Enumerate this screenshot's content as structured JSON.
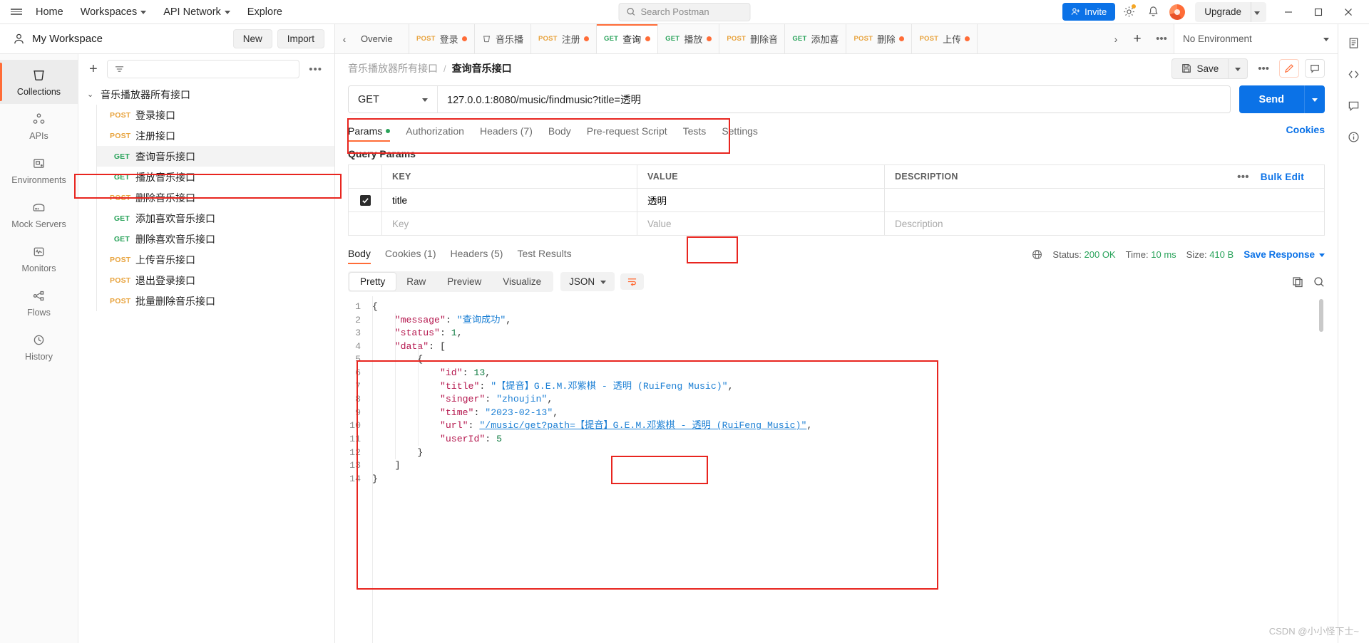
{
  "topbar": {
    "menu_icon": "hamburger-icon",
    "home": "Home",
    "workspaces": "Workspaces",
    "api_network": "API Network",
    "explore": "Explore",
    "search_placeholder": "Search Postman",
    "invite": "Invite",
    "upgrade": "Upgrade"
  },
  "workspace": {
    "name": "My Workspace",
    "new_label": "New",
    "import_label": "Import"
  },
  "rail": {
    "items": [
      {
        "label": "Collections",
        "icon": "collections-icon",
        "active": true
      },
      {
        "label": "APIs",
        "icon": "apis-icon",
        "active": false
      },
      {
        "label": "Environments",
        "icon": "environments-icon",
        "active": false
      },
      {
        "label": "Mock Servers",
        "icon": "mock-servers-icon",
        "active": false
      },
      {
        "label": "Monitors",
        "icon": "monitors-icon",
        "active": false
      },
      {
        "label": "Flows",
        "icon": "flows-icon",
        "active": false
      },
      {
        "label": "History",
        "icon": "history-icon",
        "active": false
      }
    ]
  },
  "tree": {
    "filter_placeholder": "",
    "collection": "音乐播放器所有接口",
    "requests": [
      {
        "method": "POST",
        "name": "登录接口",
        "selected": false
      },
      {
        "method": "POST",
        "name": "注册接口",
        "selected": false
      },
      {
        "method": "GET",
        "name": "查询音乐接口",
        "selected": true
      },
      {
        "method": "GET",
        "name": "播放音乐接口",
        "selected": false
      },
      {
        "method": "POST",
        "name": "删除音乐接口",
        "selected": false
      },
      {
        "method": "GET",
        "name": "添加喜欢音乐接口",
        "selected": false
      },
      {
        "method": "GET",
        "name": "删除喜欢音乐接口",
        "selected": false
      },
      {
        "method": "POST",
        "name": "上传音乐接口",
        "selected": false
      },
      {
        "method": "POST",
        "name": "退出登录接口",
        "selected": false
      },
      {
        "method": "POST",
        "name": "批量删除音乐接口",
        "selected": false
      }
    ]
  },
  "tabs": {
    "items": [
      {
        "method": "",
        "label": "Overvie",
        "unsaved": false,
        "active": false
      },
      {
        "method": "POST",
        "label": "登录",
        "unsaved": true,
        "active": false
      },
      {
        "method": "",
        "label": "音乐播",
        "unsaved": false,
        "active": false
      },
      {
        "method": "POST",
        "label": "注册",
        "unsaved": true,
        "active": false
      },
      {
        "method": "GET",
        "label": "查询",
        "unsaved": true,
        "active": true
      },
      {
        "method": "GET",
        "label": "播放",
        "unsaved": true,
        "active": false
      },
      {
        "method": "POST",
        "label": "删除音",
        "unsaved": false,
        "active": false
      },
      {
        "method": "GET",
        "label": "添加喜",
        "unsaved": false,
        "active": false
      },
      {
        "method": "POST",
        "label": "删除",
        "unsaved": true,
        "active": false
      },
      {
        "method": "POST",
        "label": "上传",
        "unsaved": true,
        "active": false
      }
    ],
    "environment": "No Environment"
  },
  "breadcrumb": {
    "collection": "音乐播放器所有接口",
    "separator": "/",
    "request": "查询音乐接口",
    "save_label": "Save"
  },
  "request": {
    "method": "GET",
    "url": "127.0.0.1:8080/music/findmusic?title=透明",
    "send_label": "Send",
    "cookies_link": "Cookies",
    "tabs": [
      {
        "label": "Params",
        "active": true,
        "dot": true
      },
      {
        "label": "Authorization",
        "active": false,
        "dot": false
      },
      {
        "label": "Headers (7)",
        "active": false,
        "dot": false
      },
      {
        "label": "Body",
        "active": false,
        "dot": false
      },
      {
        "label": "Pre-request Script",
        "active": false,
        "dot": false
      },
      {
        "label": "Tests",
        "active": false,
        "dot": false
      },
      {
        "label": "Settings",
        "active": false,
        "dot": false
      }
    ],
    "query_params_title": "Query Params",
    "table": {
      "headers": [
        "KEY",
        "VALUE",
        "DESCRIPTION"
      ],
      "bulk_edit": "Bulk Edit",
      "rows": [
        {
          "checked": true,
          "key": "title",
          "value": "透明",
          "description": ""
        }
      ],
      "placeholder_row": {
        "key": "Key",
        "value": "Value",
        "description": "Description"
      }
    }
  },
  "response": {
    "tabs": [
      {
        "label": "Body",
        "active": true
      },
      {
        "label": "Cookies (1)",
        "active": false
      },
      {
        "label": "Headers (5)",
        "active": false
      },
      {
        "label": "Test Results",
        "active": false
      }
    ],
    "status_label": "Status:",
    "status_value": "200 OK",
    "time_label": "Time:",
    "time_value": "10 ms",
    "size_label": "Size:",
    "size_value": "410 B",
    "save_response": "Save Response",
    "view_modes": [
      {
        "label": "Pretty",
        "active": true
      },
      {
        "label": "Raw",
        "active": false
      },
      {
        "label": "Preview",
        "active": false
      },
      {
        "label": "Visualize",
        "active": false
      }
    ],
    "format": "JSON",
    "body_lines": [
      {
        "n": "1",
        "indent": 0,
        "tokens": [
          {
            "t": "{",
            "c": "p"
          }
        ]
      },
      {
        "n": "2",
        "indent": 0,
        "tokens": [
          {
            "t": "    \"message\"",
            "c": "k"
          },
          {
            "t": ": ",
            "c": "p"
          },
          {
            "t": "\"查询成功\"",
            "c": "s"
          },
          {
            "t": ",",
            "c": "p"
          }
        ]
      },
      {
        "n": "3",
        "indent": 0,
        "tokens": [
          {
            "t": "    \"status\"",
            "c": "k"
          },
          {
            "t": ": ",
            "c": "p"
          },
          {
            "t": "1",
            "c": "n"
          },
          {
            "t": ",",
            "c": "p"
          }
        ]
      },
      {
        "n": "4",
        "indent": 0,
        "tokens": [
          {
            "t": "    \"data\"",
            "c": "k"
          },
          {
            "t": ": ",
            "c": "p"
          },
          {
            "t": "[",
            "c": "p"
          }
        ]
      },
      {
        "n": "5",
        "indent": 0,
        "tokens": [
          {
            "t": "        {",
            "c": "p"
          }
        ]
      },
      {
        "n": "6",
        "indent": 0,
        "tokens": [
          {
            "t": "            \"id\"",
            "c": "k"
          },
          {
            "t": ": ",
            "c": "p"
          },
          {
            "t": "13",
            "c": "n"
          },
          {
            "t": ",",
            "c": "p"
          }
        ]
      },
      {
        "n": "7",
        "indent": 0,
        "tokens": [
          {
            "t": "            \"title\"",
            "c": "k"
          },
          {
            "t": ": ",
            "c": "p"
          },
          {
            "t": "\"【提音】G.E.M.邓紫棋 - 透明 (RuiFeng Music)\"",
            "c": "s"
          },
          {
            "t": ",",
            "c": "p"
          }
        ]
      },
      {
        "n": "8",
        "indent": 0,
        "tokens": [
          {
            "t": "            \"singer\"",
            "c": "k"
          },
          {
            "t": ": ",
            "c": "p"
          },
          {
            "t": "\"zhoujin\"",
            "c": "s"
          },
          {
            "t": ",",
            "c": "p"
          }
        ]
      },
      {
        "n": "9",
        "indent": 0,
        "tokens": [
          {
            "t": "            \"time\"",
            "c": "k"
          },
          {
            "t": ": ",
            "c": "p"
          },
          {
            "t": "\"2023-02-13\"",
            "c": "s"
          },
          {
            "t": ",",
            "c": "p"
          }
        ]
      },
      {
        "n": "10",
        "indent": 0,
        "tokens": [
          {
            "t": "            \"url\"",
            "c": "k"
          },
          {
            "t": ": ",
            "c": "p"
          },
          {
            "t": "\"/music/get?path=【提音】G.E.M.邓紫棋 - 透明 (RuiFeng Music)\"",
            "c": "lnk"
          },
          {
            "t": ",",
            "c": "p"
          }
        ]
      },
      {
        "n": "11",
        "indent": 0,
        "tokens": [
          {
            "t": "            \"userId\"",
            "c": "k"
          },
          {
            "t": ": ",
            "c": "p"
          },
          {
            "t": "5",
            "c": "n"
          }
        ]
      },
      {
        "n": "12",
        "indent": 0,
        "tokens": [
          {
            "t": "        }",
            "c": "p"
          }
        ]
      },
      {
        "n": "13",
        "indent": 0,
        "tokens": [
          {
            "t": "    ]",
            "c": "p"
          }
        ]
      },
      {
        "n": "14",
        "indent": 0,
        "tokens": [
          {
            "t": "}",
            "c": "p"
          }
        ]
      }
    ]
  },
  "watermark": "CSDN @小小怪下士~",
  "colors": {
    "accent": "#ff6c37",
    "blue": "#0b72e7",
    "get": "#2aa35b",
    "post": "#e8a33d",
    "annotation": "#e8251f"
  }
}
